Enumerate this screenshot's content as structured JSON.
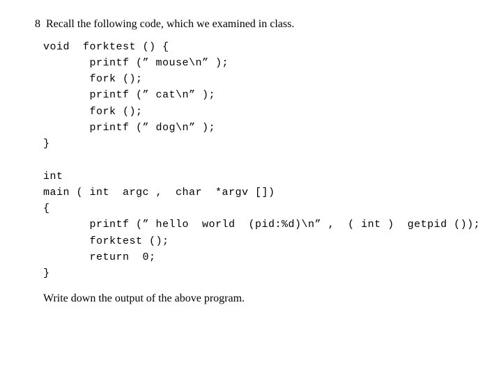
{
  "question": {
    "number": "8",
    "prompt": "Recall the following code, which we examined in class."
  },
  "code": {
    "l1": "void  forktest () {",
    "l2": "       printf (” mouse\\n” );",
    "l3": "       fork ();",
    "l4": "       printf (” cat\\n” );",
    "l5": "       fork ();",
    "l6": "       printf (” dog\\n” );",
    "l7": "}",
    "l8": "",
    "l9": "int",
    "l10": "main ( int  argc ,  char  *argv [])",
    "l11": "{",
    "l12": "       printf (” hello  world  (pid:%d)\\n” ,  ( int )  getpid ());",
    "l13": "       forktest ();",
    "l14": "       return  0;",
    "l15": "}"
  },
  "followup": "Write down the output of the above program."
}
